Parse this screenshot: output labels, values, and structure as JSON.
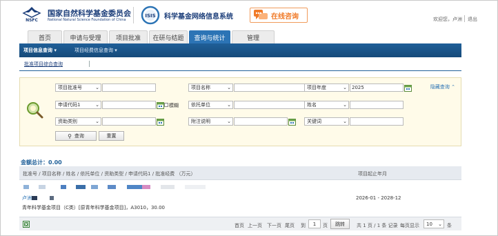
{
  "header": {
    "org_name_cn": "国家自然科学基金委员会",
    "org_name_en": "National Natural Science Foundation of China",
    "org_abbr": "NSFC",
    "isis_logo_text": "ISIS",
    "system_title": "科学基金网络信息系统",
    "consult_label": "在线咨询",
    "welcome_text": "欢迎您，卢洲",
    "logout_label": "退出"
  },
  "tabs": [
    {
      "label": "首页"
    },
    {
      "label": "申请与受理"
    },
    {
      "label": "项目批准"
    },
    {
      "label": "在研与结题"
    },
    {
      "label": "查询与统计",
      "active": true
    },
    {
      "label": "管理"
    }
  ],
  "subnav": {
    "items": [
      {
        "label": "项目信息查询",
        "active": true
      },
      {
        "label": "项目经费信息查询"
      }
    ],
    "breadcrumb": "批准项目综合查询"
  },
  "search": {
    "hide_label": "隐藏查询",
    "row1": {
      "sel1": "项目批准号",
      "val1": "",
      "sel2": "项目名称",
      "val2": "",
      "sel3": "项目年度",
      "val3": "2025"
    },
    "row2": {
      "sel1": "申请代码1",
      "val1": "",
      "fuzzy_label": "模糊",
      "sel2": "依托单位",
      "val2": "",
      "sel3": "姓名",
      "val3": ""
    },
    "row3": {
      "sel1": "资助类别",
      "val1": "",
      "sel2": "附注说明",
      "val2": "",
      "sel3": "关键词",
      "val3": ""
    },
    "query_button": "查询",
    "reset_button": "重置"
  },
  "results": {
    "amount_label": "金额总计：",
    "amount_value": "0.00",
    "col_main": "批准号 / 项目名称 / 姓名 / 依托单位 / 资助类型 / 申请代码1 / 批准经费 （万元）",
    "col_period": "项目起止年月",
    "rows": [
      {
        "person": "卢洲",
        "detail": "青年科学基金项目（C类）[原青年科学基金项目]，A3010，30.00",
        "period": "2026-01 - 2028-12"
      }
    ]
  },
  "pager": {
    "first": "首页",
    "prev": "上一页",
    "next": "下一页",
    "last": "尾页",
    "goto_label": "到",
    "page_value": "1",
    "page_unit": "页",
    "jump": "跳转",
    "summary": "共 1 页 / 1 条 记录",
    "per_page_label": "每页显示",
    "per_page_value": "10",
    "per_page_unit": "条"
  },
  "colors": {
    "tab_active": "#2c74b5",
    "subnav_bg": "#1f5f98",
    "search_bg": "#fffbe9",
    "consult_orange": "#f07a28"
  }
}
